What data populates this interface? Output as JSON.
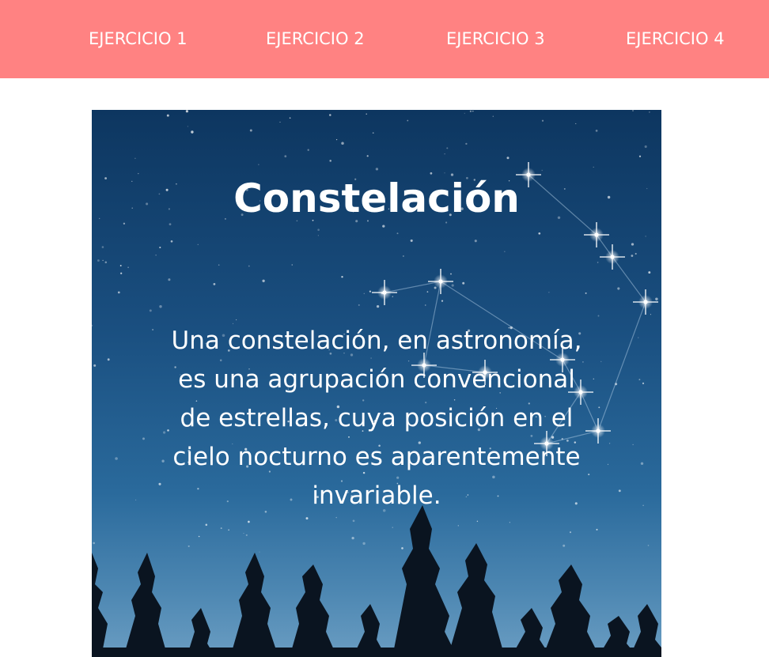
{
  "nav": {
    "items": [
      {
        "label": "EJERCICIO 1"
      },
      {
        "label": "EJERCICIO 2"
      },
      {
        "label": "EJERCICIO 3"
      },
      {
        "label": "EJERCICIO 4"
      }
    ]
  },
  "card": {
    "title": "Constelación",
    "text": "Una constelación, en astronomía, es una agrupación convencional de estrellas, cuya posición en el cielo nocturno es aparentemente invariable.",
    "background": "night-sky-constellation-image"
  },
  "colors": {
    "nav_background": "#ff8282",
    "nav_text": "#ffffff",
    "card_text": "#ffffff",
    "page_background": "#ffffff"
  }
}
